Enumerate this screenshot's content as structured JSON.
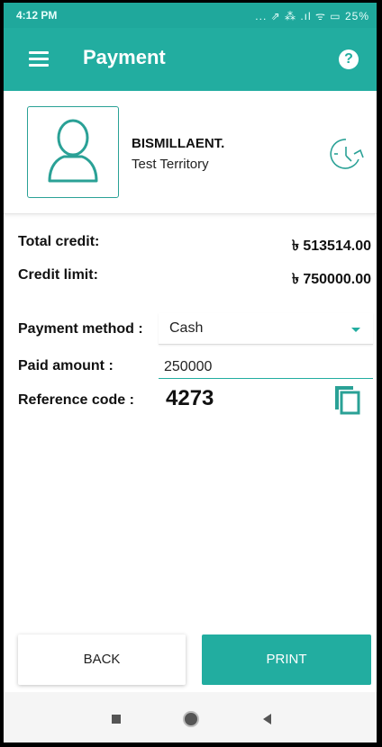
{
  "status_bar": {
    "time": "4:12 PM",
    "icons_text": "... ⇗ ⁂ .ıl ᯤ ▭ 25%"
  },
  "app_bar": {
    "title": "Payment",
    "help_glyph": "?"
  },
  "customer": {
    "name": "BISMILLAENT.",
    "territory": "Test Territory"
  },
  "summary": {
    "total_credit_label": "Total credit:",
    "total_credit_value": "৳ 513514.00",
    "credit_limit_label": "Credit limit:",
    "credit_limit_value": "৳ 750000.00"
  },
  "form": {
    "payment_method_label": "Payment method :",
    "payment_method_value": "Cash",
    "paid_amount_label": "Paid amount :",
    "paid_amount_value": "250000",
    "reference_code_label": "Reference code :",
    "reference_code_value": "4273"
  },
  "buttons": {
    "back_label": "BACK",
    "print_label": "PRINT"
  },
  "colors": {
    "accent": "#22ada0",
    "status_bar": "#1fa89c"
  },
  "icons": [
    "menu-icon",
    "help-icon",
    "avatar-person-icon",
    "history-clock-icon",
    "copy-icon",
    "dropdown-arrow-icon"
  ]
}
